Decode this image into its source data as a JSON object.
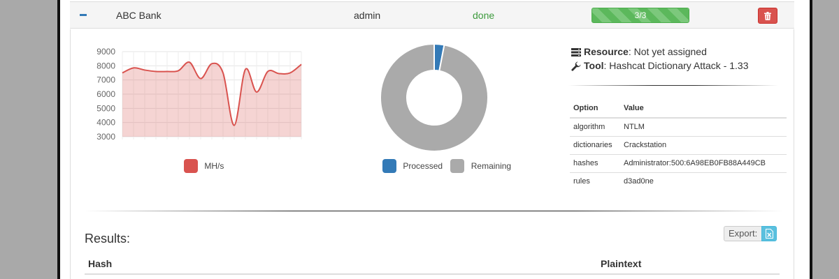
{
  "job": {
    "name": "ABC Bank",
    "user": "admin",
    "status": "done",
    "progress_text": "3/3",
    "progress_fraction": 1.0
  },
  "speed_chart": {
    "y_ticks": [
      "9000",
      "8000",
      "7000",
      "6000",
      "5000",
      "4000",
      "3000"
    ],
    "legend_label": "MH/s",
    "color": "#d9534f"
  },
  "chart_data": [
    {
      "type": "area",
      "ylim": [
        3000,
        9000
      ],
      "values": [
        7500,
        7850,
        7700,
        7600,
        7600,
        7650,
        8250,
        7100,
        8150,
        7500,
        3800,
        7750,
        6150,
        7600,
        7450,
        7500,
        8100
      ],
      "series": [
        {
          "name": "MH/s",
          "color": "#d9534f"
        }
      ]
    },
    {
      "type": "pie",
      "categories": [
        "Processed",
        "Remaining"
      ],
      "values": [
        3,
        97
      ],
      "colors": [
        "#337ab7",
        "#aaaaaa"
      ]
    }
  ],
  "donut_legend": {
    "processed": "Processed",
    "remaining": "Remaining"
  },
  "info": {
    "resource_label": "Resource",
    "resource_value": ": Not yet assigned",
    "tool_label": "Tool",
    "tool_value": ": Hashcat Dictionary Attack - 1.33"
  },
  "options_table": {
    "headers": [
      "Option",
      "Value"
    ],
    "rows": [
      [
        "algorithm",
        "NTLM"
      ],
      [
        "dictionaries",
        "Crackstation"
      ],
      [
        "hashes",
        "Administrator:500:6A98EB0FB88A449CB"
      ],
      [
        "rules",
        "d3ad0ne"
      ]
    ]
  },
  "results": {
    "title": "Results:",
    "export_label": "Export:",
    "headers": [
      "Hash",
      "Plaintext"
    ]
  }
}
